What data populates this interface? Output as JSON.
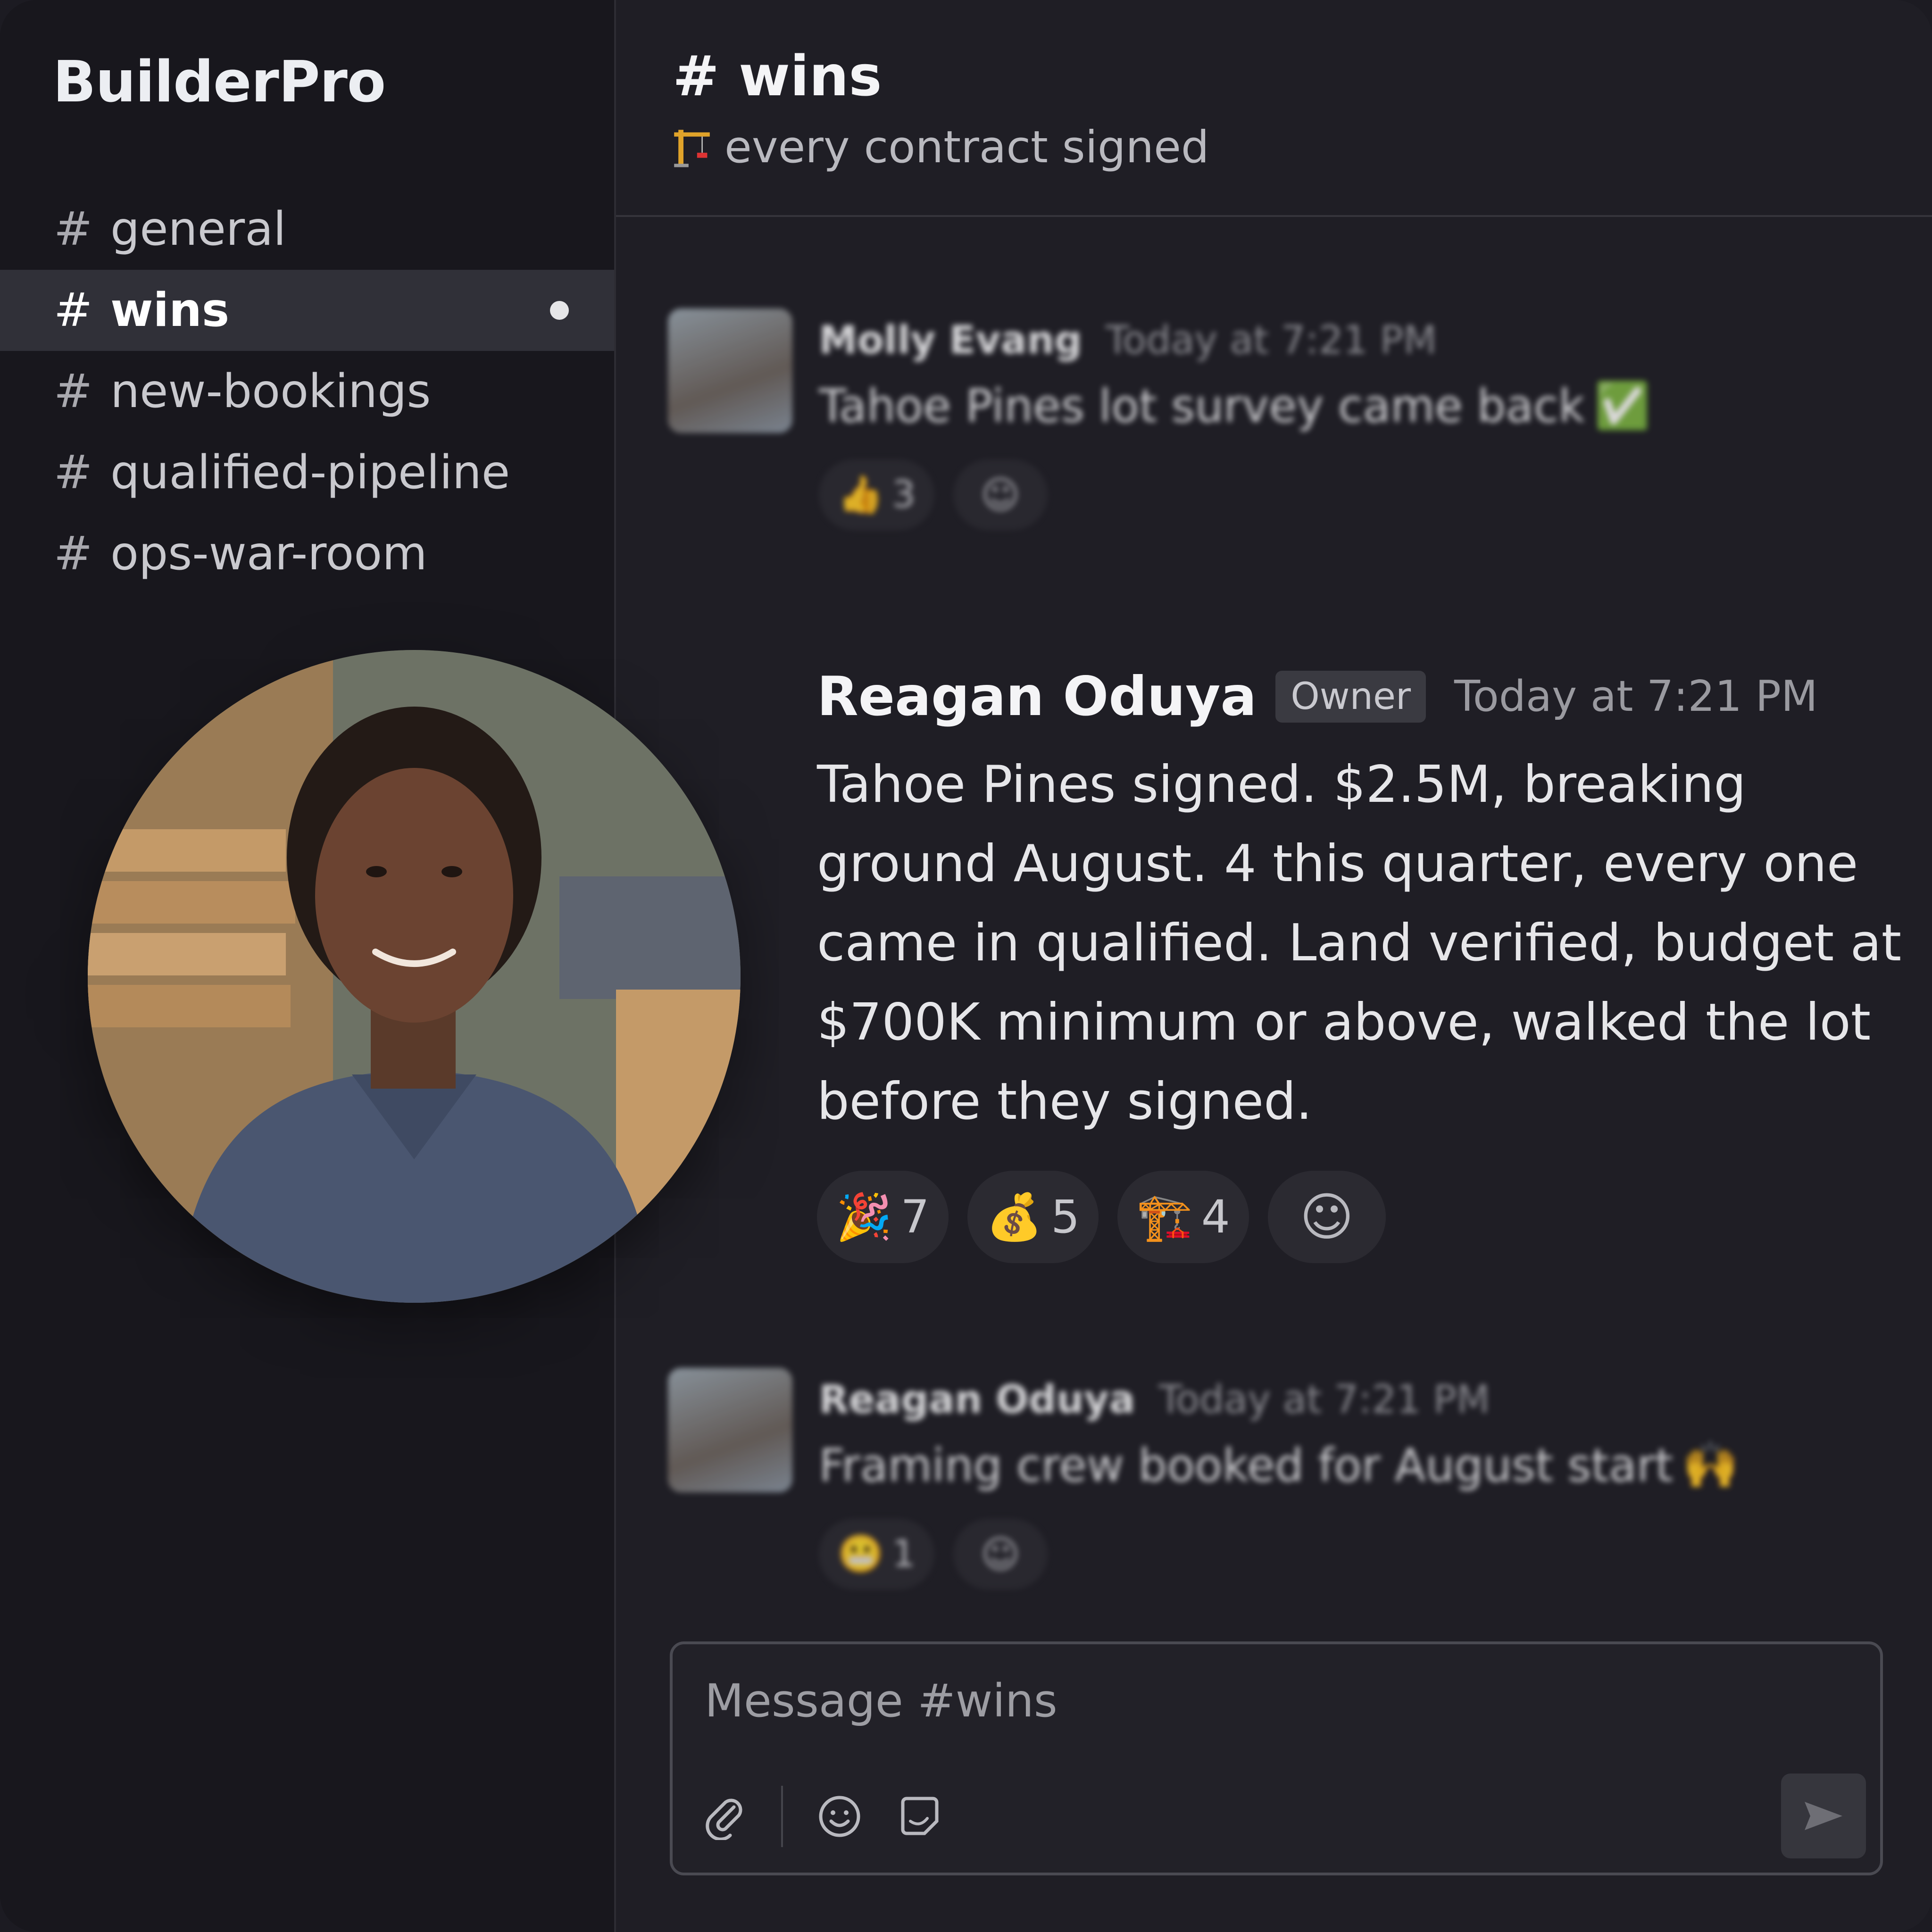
{
  "workspace": {
    "name": "BuilderPro"
  },
  "sidebar": {
    "channels": [
      {
        "hash": "#",
        "label": "general",
        "active": false
      },
      {
        "hash": "#",
        "label": "wins",
        "active": true,
        "unread": true
      },
      {
        "hash": "#",
        "label": "new-bookings",
        "active": false
      },
      {
        "hash": "#",
        "label": "qualified-pipeline",
        "active": false
      },
      {
        "hash": "#",
        "label": "ops-war-room",
        "active": false
      }
    ]
  },
  "header": {
    "title": "# wins",
    "topic_icon": "crane-icon",
    "topic": "every contract signed"
  },
  "messages": [
    {
      "author": "Molly Evang",
      "time": "Today at 7:21 PM",
      "text": "Tahoe Pines lot survey came back",
      "text_emoji": "✅",
      "reactions": [
        {
          "emoji": "👍",
          "count": "3"
        }
      ]
    },
    {
      "author": "Reagan Oduya",
      "badge": "Owner",
      "time": "Today at 7:21 PM",
      "text": "Tahoe Pines signed. $2.5M, breaking ground August. 4 this quarter, every one came in qualified. Land verified, budget at $700K minimum or above, walked the lot before they signed.",
      "reactions": [
        {
          "emoji": "🎉",
          "count": "7"
        },
        {
          "emoji": "💰",
          "count": "5"
        },
        {
          "emoji": "🏗️",
          "count": "4"
        }
      ]
    },
    {
      "author": "Reagan Oduya",
      "time": "Today at 7:21 PM",
      "text": "Framing crew booked for August start",
      "text_emoji": "🙌",
      "reactions": [
        {
          "emoji": "😬",
          "count": "1"
        }
      ]
    }
  ],
  "composer": {
    "placeholder": "Message #wins"
  },
  "colors": {
    "background": "#1f1e25",
    "sidebar": "#18171d",
    "active_channel": "#303038"
  }
}
